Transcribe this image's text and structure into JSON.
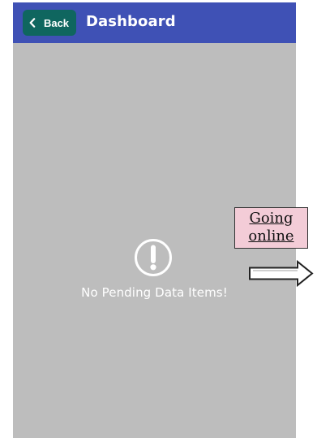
{
  "header": {
    "back_label": "Back",
    "title": "Dashboard"
  },
  "empty_state": {
    "icon": "exclamation-circle-icon",
    "message": "No Pending Data Items!"
  },
  "annotation": {
    "line1": "Going",
    "line2": "online"
  },
  "colors": {
    "app_bar": "#3f51b5",
    "back_button": "#0f665f",
    "content_background": "#bdbdbd",
    "annotation_background": "#f3ccd7"
  }
}
